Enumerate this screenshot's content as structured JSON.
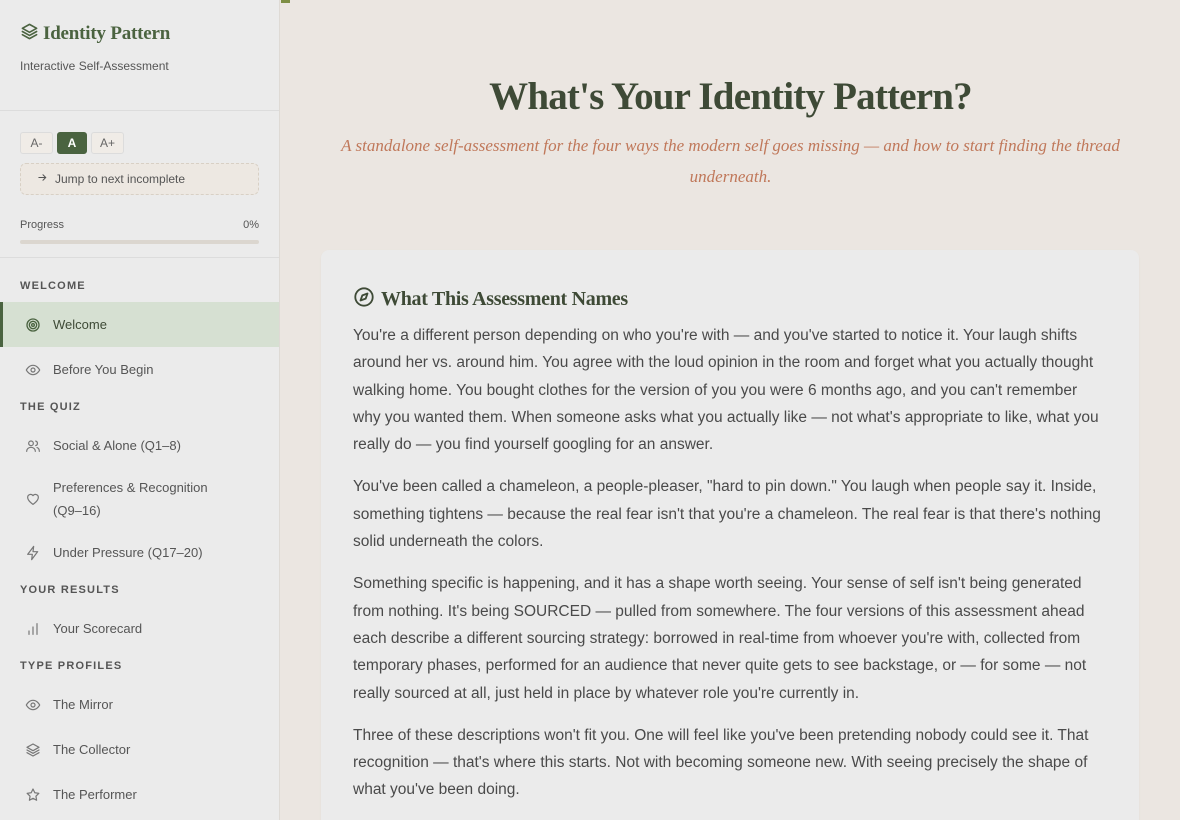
{
  "sidebar": {
    "brand": {
      "title": "Identity Pattern",
      "subtitle": "Interactive Self-Assessment"
    },
    "font_buttons": {
      "decrease": "A-",
      "normal": "A",
      "increase": "A+"
    },
    "jump_label": "Jump to next incomplete",
    "progress": {
      "label": "Progress",
      "value_text": "0%",
      "fraction": 0
    },
    "sections": [
      {
        "title": "WELCOME",
        "items": [
          {
            "label": "Welcome",
            "icon": "target-icon",
            "active": true
          },
          {
            "label": "Before You Begin",
            "icon": "eye-icon"
          }
        ]
      },
      {
        "title": "THE QUIZ",
        "items": [
          {
            "label": "Social & Alone (Q1–8)",
            "icon": "users-icon"
          },
          {
            "label": "Preferences & Recognition (Q9–16)",
            "icon": "heart-icon"
          },
          {
            "label": "Under Pressure (Q17–20)",
            "icon": "bolt-icon"
          }
        ]
      },
      {
        "title": "YOUR RESULTS",
        "items": [
          {
            "label": "Your Scorecard",
            "icon": "bar-chart-icon"
          }
        ]
      },
      {
        "title": "TYPE PROFILES",
        "items": [
          {
            "label": "The Mirror",
            "icon": "eye-icon"
          },
          {
            "label": "The Collector",
            "icon": "layers-icon"
          },
          {
            "label": "The Performer",
            "icon": "star-icon"
          }
        ]
      }
    ]
  },
  "main": {
    "title": "What's Your Identity Pattern?",
    "subtitle": "A standalone self-assessment for the four ways the modern self goes missing — and how to start finding the thread underneath.",
    "card": {
      "title": "What This Assessment Names",
      "icon": "compass-icon",
      "paragraphs": [
        "You're a different person depending on who you're with — and you've started to notice it. Your laugh shifts around her vs. around him. You agree with the loud opinion in the room and forget what you actually thought walking home. You bought clothes for the version of you you were 6 months ago, and you can't remember why you wanted them. When someone asks what you actually like — not what's appropriate to like, what you really do — you find yourself googling for an answer.",
        "You've been called a chameleon, a people-pleaser, \"hard to pin down.\" You laugh when people say it. Inside, something tightens — because the real fear isn't that you're a chameleon. The real fear is that there's nothing solid underneath the colors.",
        "Something specific is happening, and it has a shape worth seeing. Your sense of self isn't being generated from nothing. It's being SOURCED — pulled from somewhere. The four versions of this assessment ahead each describe a different sourcing strategy: borrowed in real-time from whoever you're with, collected from temporary phases, performed for an audience that never quite gets to see backstage, or — for some — not really sourced at all, just held in place by whatever role you're currently in.",
        "Three of these descriptions won't fit you. One will feel like you've been pretending nobody could see it. That recognition — that's where this starts. Not with becoming someone new. With seeing precisely the shape of what you've been doing."
      ]
    }
  },
  "colors": {
    "accent": "#4a6340",
    "subtitle": "#c0785a",
    "active_bg": "#d6e0d2"
  }
}
